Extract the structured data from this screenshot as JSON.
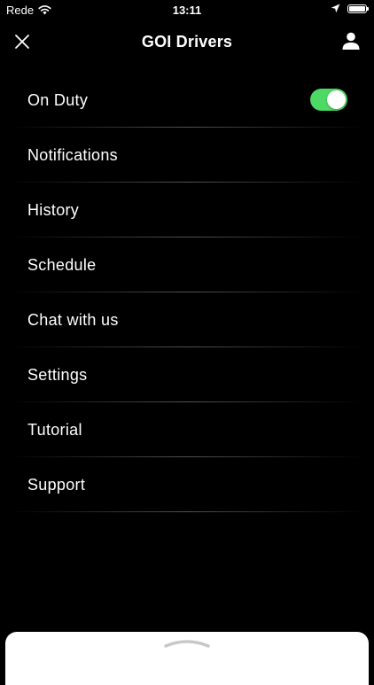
{
  "status_bar": {
    "carrier": "Rede",
    "time": "13:11",
    "battery_level": 1.0
  },
  "header": {
    "title": "GOI Drivers",
    "close_icon": "close-icon",
    "profile_icon": "person-icon"
  },
  "menu": {
    "on_duty": {
      "label": "On Duty",
      "enabled": true,
      "toggle_color": "#4cd964"
    },
    "items": [
      {
        "label": "Notifications"
      },
      {
        "label": "History"
      },
      {
        "label": "Schedule"
      },
      {
        "label": "Chat with us"
      },
      {
        "label": "Settings"
      },
      {
        "label": "Tutorial"
      },
      {
        "label": "Support"
      }
    ]
  },
  "bottom_sheet": {
    "handle_icon": "chevron-up-icon"
  }
}
